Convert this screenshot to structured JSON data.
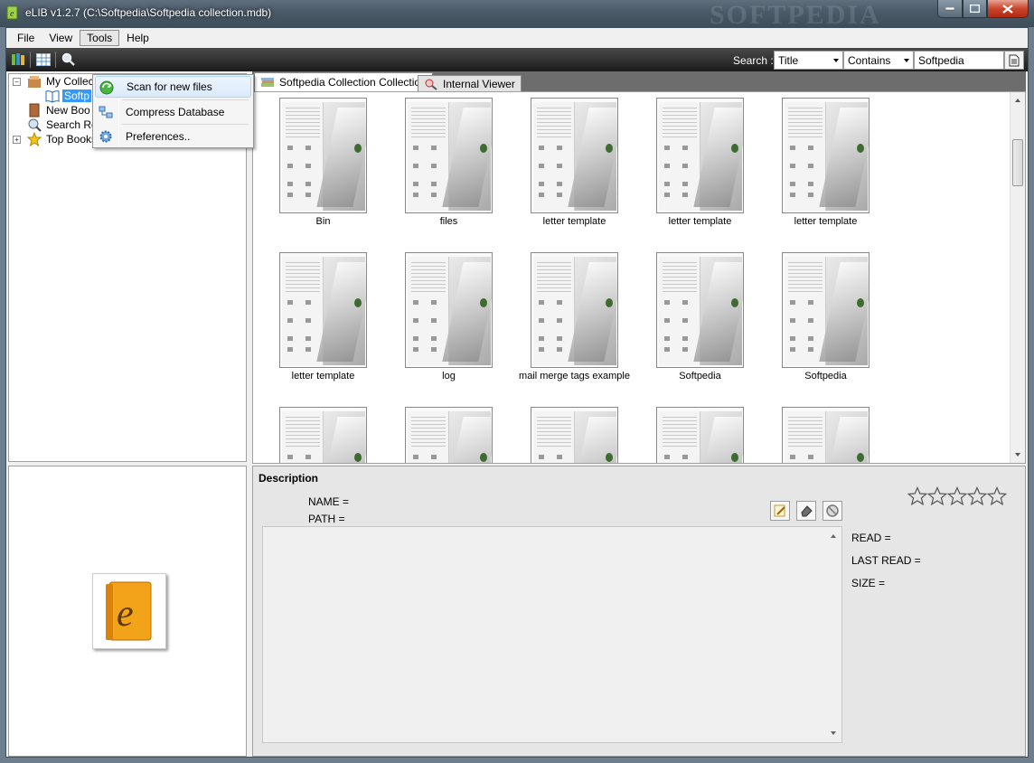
{
  "window": {
    "title": "eLIB v1.2.7 (C:\\Softpedia\\Softpedia collection.mdb)",
    "watermark": "SOFTPEDIA",
    "accent_color": "#3399ff"
  },
  "menubar": {
    "items": [
      {
        "label": "File"
      },
      {
        "label": "View"
      },
      {
        "label": "Tools"
      },
      {
        "label": "Help"
      }
    ]
  },
  "tools_menu": {
    "items": [
      {
        "label": "Scan for new files",
        "icon": "refresh-icon"
      },
      {
        "label": "Compress Database",
        "icon": "compress-icon"
      },
      {
        "label": "Preferences..",
        "icon": "gear-icon"
      }
    ]
  },
  "toolbar": {
    "search_label": "Search :",
    "field_value": "Title",
    "operator_value": "Contains",
    "query_value": "Softpedia"
  },
  "tree": {
    "items": [
      {
        "label": "My Collec",
        "icon": "collection-icon"
      },
      {
        "label": "Softp",
        "icon": "book-icon"
      },
      {
        "label": "New Boo",
        "icon": "new-book-icon"
      },
      {
        "label": "Search Results",
        "icon": "search-results-icon"
      },
      {
        "label": "Top Books",
        "icon": "star-icon"
      }
    ]
  },
  "tabs": [
    {
      "label": "Softpedia Collection Collection"
    },
    {
      "label": "Internal Viewer"
    }
  ],
  "gallery": {
    "items": [
      {
        "label": "Bin"
      },
      {
        "label": "files"
      },
      {
        "label": "letter template"
      },
      {
        "label": "letter template"
      },
      {
        "label": "letter template"
      },
      {
        "label": "letter template"
      },
      {
        "label": "log"
      },
      {
        "label": "mail merge tags example"
      },
      {
        "label": "Softpedia"
      },
      {
        "label": "Softpedia"
      },
      {
        "label": ""
      },
      {
        "label": ""
      },
      {
        "label": ""
      },
      {
        "label": ""
      },
      {
        "label": ""
      }
    ]
  },
  "description": {
    "title": "Description",
    "name_label": "NAME =",
    "path_label": "PATH =",
    "read_label": "READ =",
    "last_read_label": "LAST READ =",
    "size_label": "SIZE =",
    "rating": 0,
    "rating_max": 5
  }
}
